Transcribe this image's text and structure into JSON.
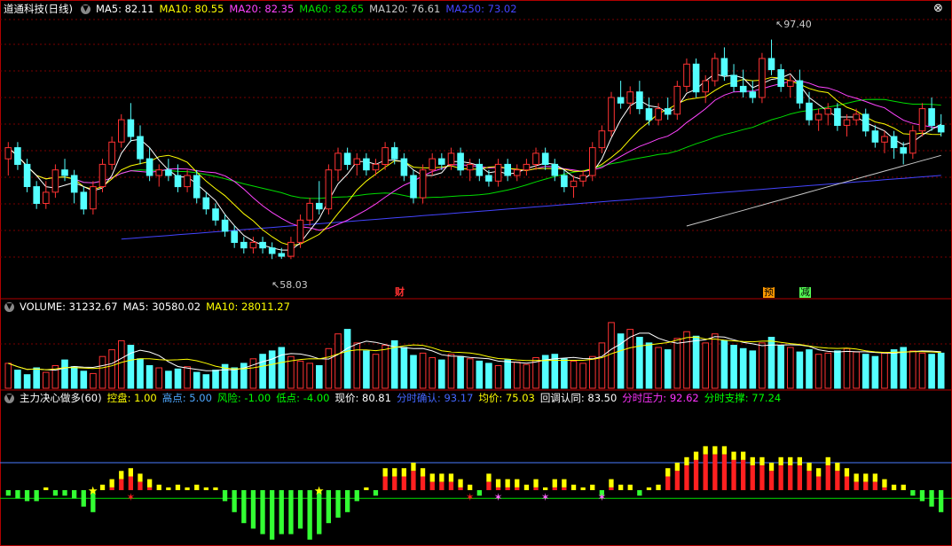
{
  "colors": {
    "up": "#ff3232",
    "down": "#54ffff",
    "grid": "#7a0000",
    "frame": "#b00000",
    "ma5": "#ffffff",
    "ma10": "#ffff00",
    "ma20": "#ff44ff",
    "ma60": "#00dd00",
    "ma120": "#c8c8c8",
    "ma250": "#4444ff",
    "hi_line": "#4a7cff",
    "lo_line": "#00dd00",
    "kp": "#ffff00",
    "gd": "#4ea8ff",
    "fx": "#00ff00",
    "dd": "#00ff00",
    "xj": "#ffffff",
    "fsqr": "#4466ff",
    "jj": "#ffff00",
    "hdqr": "#ffffff",
    "fsyl": "#ff33ff",
    "fszc": "#00ff00"
  },
  "price_header": {
    "title": "道通科技(日线)",
    "ma5": "MA5: 82.11",
    "ma10": "MA10: 80.55",
    "ma20": "MA20: 82.35",
    "ma60": "MA60: 82.65",
    "ma120": "MA120: 76.61",
    "ma250": "MA250: 73.02"
  },
  "price_annotations": {
    "high": "97.40",
    "low": "58.03",
    "cai": "财",
    "yu": "预",
    "jian": "减"
  },
  "volume_header": {
    "title": "VOLUME: 31232.67",
    "ma5": "MA5: 30580.02",
    "ma10": "MA10: 28011.27"
  },
  "indicator_header": {
    "title": "主力决心做多(60)",
    "kp": "控盘: 1.00",
    "gd": "高点: 5.00",
    "fx": "风险: -1.00",
    "dd": "低点: -4.00",
    "xj": "现价: 80.81",
    "fsqr": "分时确认: 93.17",
    "jj": "均价: 75.03",
    "hdqr": "回调认同: 83.50",
    "fsyl": "分时压力: 92.62",
    "fszc": "分时支撑: 77.24"
  },
  "chart_data": [
    {
      "type": "candlestick",
      "panel": "price",
      "ylim": [
        52,
        101
      ],
      "bars_count": 100,
      "bars": [
        [
          76,
          79,
          73,
          78
        ],
        [
          78,
          79,
          74,
          75
        ],
        [
          75,
          76,
          70,
          71
        ],
        [
          71,
          72,
          67,
          68
        ],
        [
          68,
          72,
          67,
          70
        ],
        [
          70,
          75,
          69,
          74
        ],
        [
          74,
          76,
          72,
          73
        ],
        [
          73,
          74,
          68,
          70
        ],
        [
          70,
          71,
          66,
          67
        ],
        [
          67,
          72,
          66,
          71
        ],
        [
          71,
          76,
          70,
          75
        ],
        [
          75,
          80,
          74,
          79
        ],
        [
          79,
          84,
          78,
          83
        ],
        [
          83,
          86,
          79,
          80
        ],
        [
          80,
          82,
          75,
          76
        ],
        [
          76,
          78,
          72,
          73
        ],
        [
          73,
          75,
          71,
          74
        ],
        [
          74,
          76,
          72,
          73
        ],
        [
          73,
          75,
          70,
          71
        ],
        [
          71,
          74,
          70,
          73
        ],
        [
          73,
          74,
          68,
          69
        ],
        [
          69,
          70,
          66,
          67
        ],
        [
          67,
          68,
          64,
          65
        ],
        [
          65,
          66,
          62,
          63
        ],
        [
          63,
          64,
          60,
          61
        ],
        [
          61,
          62,
          59,
          60
        ],
        [
          60,
          62,
          59,
          61
        ],
        [
          61,
          62,
          59,
          60
        ],
        [
          60,
          61,
          58,
          59
        ],
        [
          59,
          60,
          58.03,
          58.5
        ],
        [
          58.5,
          62,
          58,
          61
        ],
        [
          61,
          66,
          60,
          65
        ],
        [
          65,
          69,
          64,
          68
        ],
        [
          68,
          72,
          66,
          67
        ],
        [
          67,
          75,
          66,
          74
        ],
        [
          74,
          78,
          72,
          77
        ],
        [
          77,
          78,
          74,
          75
        ],
        [
          75,
          77,
          73,
          76
        ],
        [
          76,
          77,
          73,
          74
        ],
        [
          74,
          76,
          73,
          75
        ],
        [
          75,
          79,
          74,
          78
        ],
        [
          78,
          79,
          75,
          76
        ],
        [
          76,
          77,
          72,
          73
        ],
        [
          73,
          74,
          68,
          69
        ],
        [
          69,
          75,
          68,
          74
        ],
        [
          74,
          77,
          73,
          76
        ],
        [
          76,
          77,
          74,
          75
        ],
        [
          75,
          78,
          74,
          77
        ],
        [
          77,
          78,
          73,
          74
        ],
        [
          74,
          76,
          72,
          75
        ],
        [
          75,
          76,
          72,
          73
        ],
        [
          73,
          74,
          71,
          72
        ],
        [
          72,
          76,
          71,
          75
        ],
        [
          75,
          76,
          72,
          73
        ],
        [
          73,
          75,
          72,
          74
        ],
        [
          74,
          76,
          73,
          75
        ],
        [
          75,
          78,
          74,
          77
        ],
        [
          77,
          78,
          74,
          75
        ],
        [
          75,
          76,
          72,
          73
        ],
        [
          73,
          74,
          70,
          71
        ],
        [
          71,
          73,
          69,
          72
        ],
        [
          72,
          74,
          71,
          73
        ],
        [
          73,
          79,
          72,
          78
        ],
        [
          78,
          82,
          77,
          81
        ],
        [
          81,
          88,
          80,
          87
        ],
        [
          87,
          90,
          85,
          86
        ],
        [
          86,
          89,
          84,
          88
        ],
        [
          88,
          90,
          84,
          85
        ],
        [
          85,
          87,
          82,
          83
        ],
        [
          83,
          86,
          82,
          85
        ],
        [
          85,
          87,
          83,
          84
        ],
        [
          84,
          90,
          83,
          89
        ],
        [
          89,
          94,
          88,
          93
        ],
        [
          93,
          94,
          87,
          88
        ],
        [
          88,
          91,
          86,
          90
        ],
        [
          90,
          95,
          89,
          94
        ],
        [
          94,
          96,
          90,
          91
        ],
        [
          91,
          93,
          88,
          89
        ],
        [
          89,
          92,
          87,
          88
        ],
        [
          88,
          90,
          86,
          87
        ],
        [
          87,
          95,
          86,
          94
        ],
        [
          94,
          97.4,
          91,
          92
        ],
        [
          92,
          93,
          88,
          89
        ],
        [
          89,
          91,
          87,
          90
        ],
        [
          90,
          92,
          85,
          86
        ],
        [
          86,
          88,
          82,
          83
        ],
        [
          83,
          85,
          81,
          84
        ],
        [
          84,
          86,
          82,
          85
        ],
        [
          85,
          86,
          81,
          82
        ],
        [
          82,
          84,
          80,
          83
        ],
        [
          83,
          85,
          82,
          84
        ],
        [
          84,
          85,
          80,
          81
        ],
        [
          81,
          82,
          78,
          79
        ],
        [
          79,
          81,
          77,
          80
        ],
        [
          80,
          81,
          76,
          78
        ],
        [
          78,
          79,
          75,
          77
        ],
        [
          77,
          82,
          76,
          81
        ],
        [
          81,
          86,
          80,
          85
        ],
        [
          85,
          87,
          81,
          82
        ],
        [
          82,
          84,
          80,
          80.81
        ]
      ],
      "ma250_range": [
        60,
        73.02
      ],
      "ma120_range": [
        63,
        76.61
      ]
    },
    {
      "type": "bar",
      "panel": "volume",
      "series_last": {
        "volume": 31232.67,
        "ma5": 30580.02,
        "ma10": 28011.27
      },
      "values": [
        22,
        16,
        12,
        18,
        14,
        20,
        25,
        19,
        15,
        13,
        28,
        34,
        42,
        38,
        26,
        20,
        18,
        15,
        17,
        19,
        14,
        12,
        16,
        21,
        18,
        22,
        26,
        30,
        33,
        36,
        28,
        24,
        22,
        20,
        35,
        48,
        52,
        40,
        33,
        30,
        38,
        42,
        36,
        29,
        31,
        27,
        25,
        30,
        28,
        26,
        24,
        22,
        20,
        25,
        23,
        21,
        27,
        29,
        30,
        26,
        24,
        22,
        28,
        40,
        58,
        48,
        52,
        45,
        40,
        36,
        34,
        44,
        50,
        46,
        40,
        48,
        42,
        38,
        35,
        33,
        40,
        45,
        38,
        36,
        32,
        34,
        30,
        31,
        33,
        35,
        32,
        30,
        28,
        31,
        34,
        36,
        33,
        31,
        30,
        31
      ],
      "ylim": [
        0,
        65
      ]
    },
    {
      "type": "bar",
      "panel": "indicator",
      "title": "主力决心做多(60)",
      "values": [
        -1,
        -1.5,
        -2,
        -2,
        0.5,
        -1,
        -1,
        -1.5,
        -3,
        -4,
        1,
        2,
        3.5,
        4,
        3,
        2,
        1,
        0.5,
        1,
        0.5,
        1,
        0.5,
        0.5,
        -2,
        -4,
        -6,
        -7,
        -8,
        -9,
        -8,
        -8,
        -7,
        -9,
        -8,
        -6,
        -5,
        -4,
        -2,
        0.5,
        -1,
        4,
        4,
        4,
        5,
        4,
        3,
        3,
        3,
        2,
        1,
        -1,
        3,
        2,
        2,
        2,
        1,
        2,
        0.5,
        2,
        2,
        1,
        0.5,
        1,
        -1,
        2,
        1,
        1,
        -1,
        0.5,
        1,
        4,
        5,
        6,
        7,
        8,
        8,
        8,
        7,
        7,
        6,
        6,
        5,
        6,
        6,
        6,
        5,
        4,
        6,
        5,
        4,
        3,
        3,
        3,
        2,
        1,
        1,
        -1,
        -2,
        -3,
        -4
      ],
      "ylim": [
        -12,
        12
      ]
    }
  ]
}
